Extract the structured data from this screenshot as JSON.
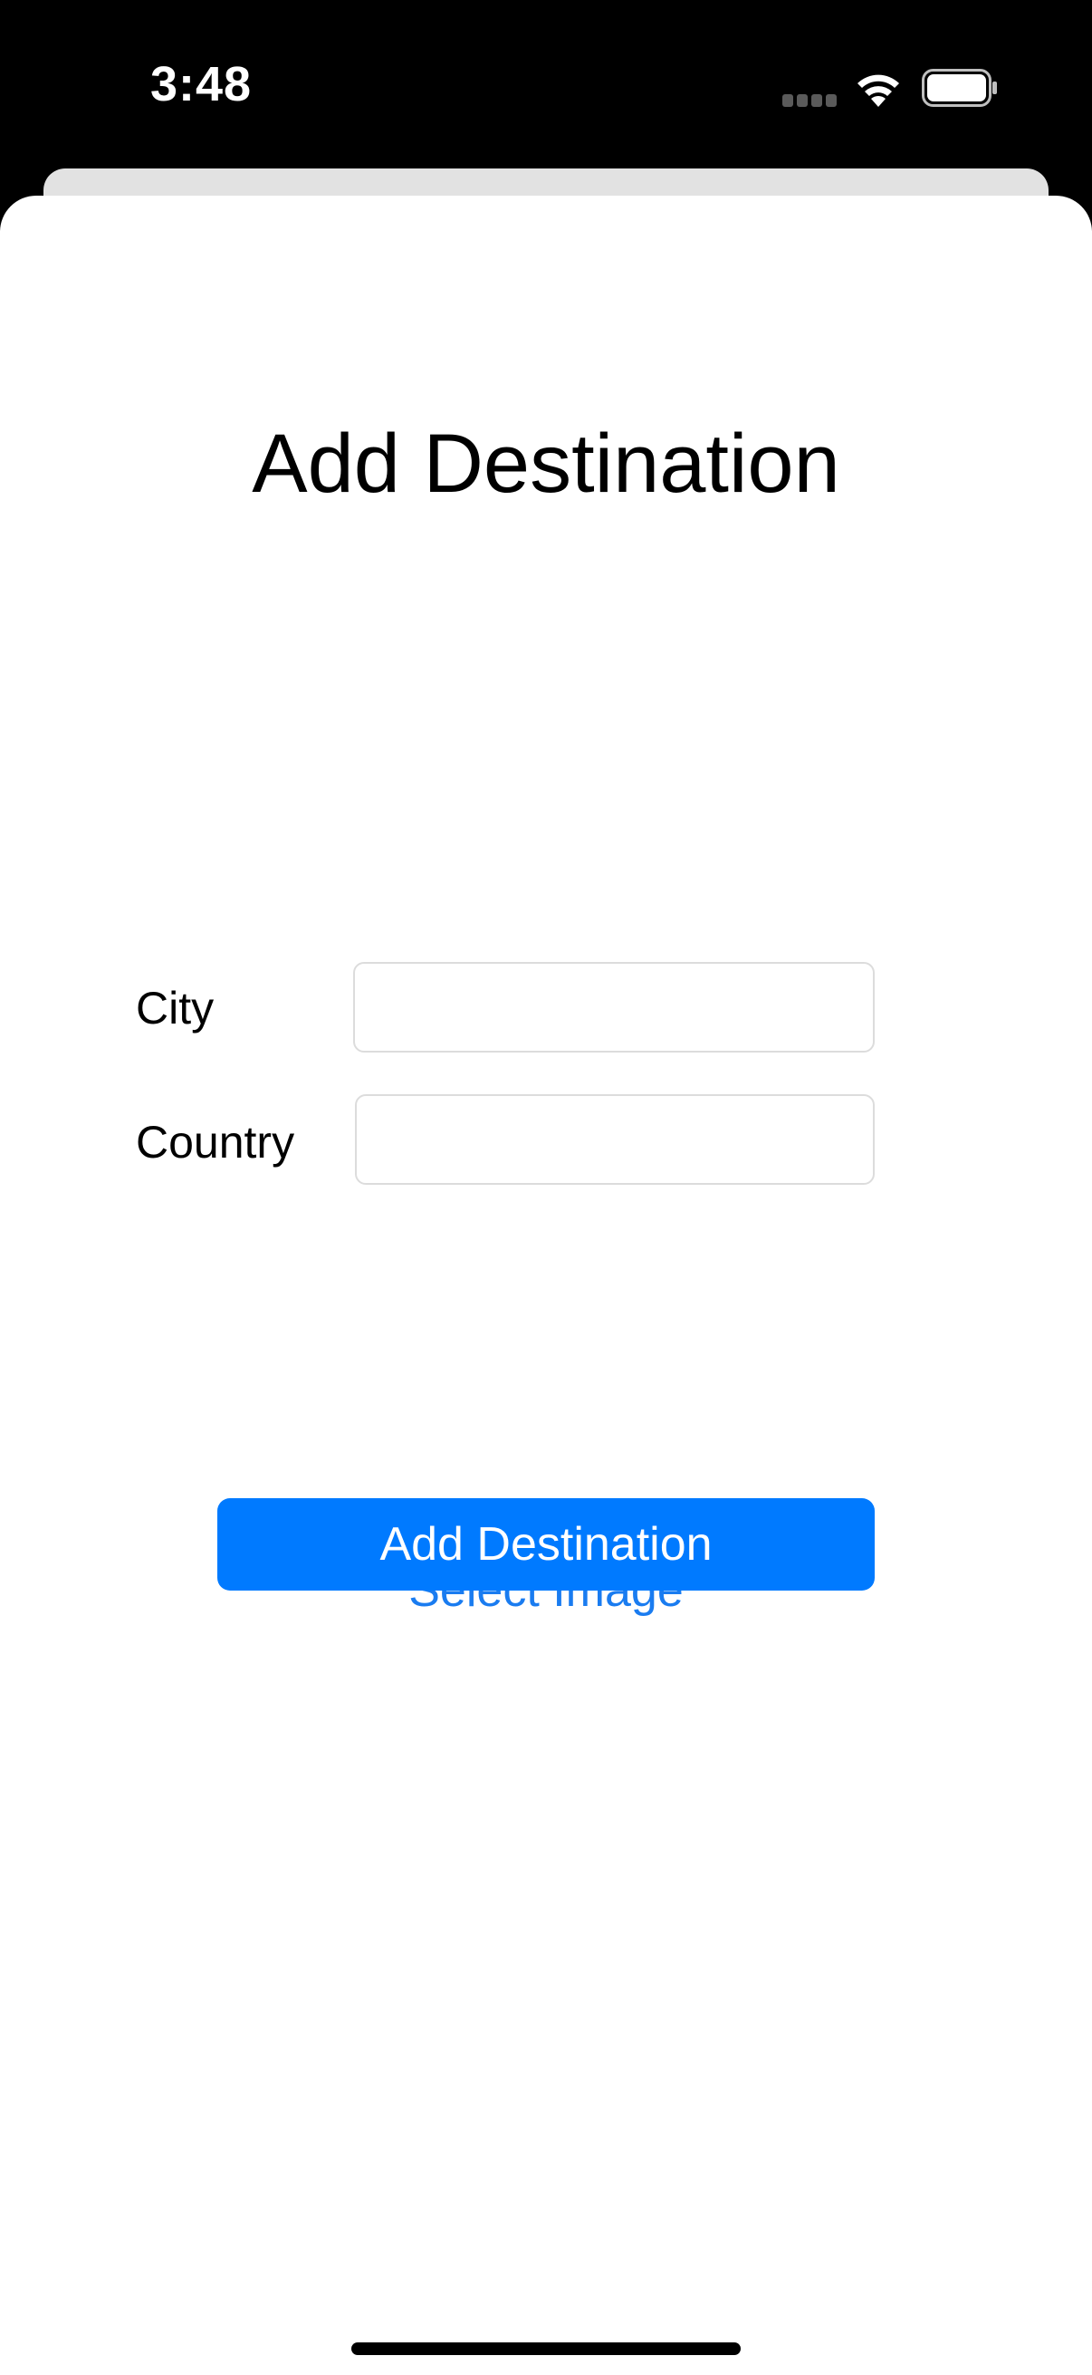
{
  "status_bar": {
    "time": "3:48",
    "icons": [
      "cellular-icon",
      "wifi-icon",
      "battery-icon"
    ]
  },
  "form": {
    "title": "Add Destination",
    "city_label": "City",
    "city_value": "",
    "country_label": "Country",
    "country_value": "",
    "select_image_label": "Select Image",
    "submit_label": "Add Destination"
  },
  "colors": {
    "accent": "#007aff",
    "link": "#1a7cf0",
    "status_bar_bg": "#000000",
    "sheet_bg": "#ffffff"
  }
}
